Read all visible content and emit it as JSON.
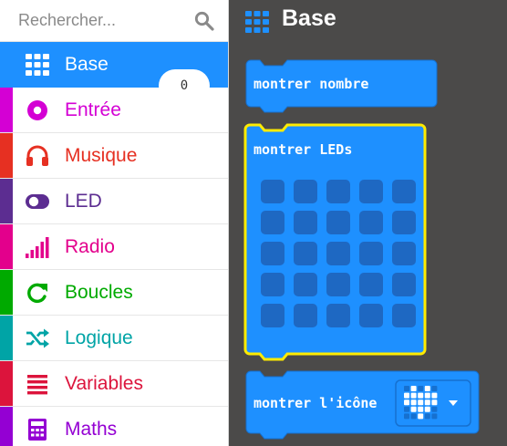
{
  "search": {
    "placeholder": "Rechercher..."
  },
  "categories": [
    {
      "label": "Base",
      "color": "#1e90ff",
      "icon": "grid-icon"
    },
    {
      "label": "Entrée",
      "color": "#d400d4",
      "icon": "radio-button-icon"
    },
    {
      "label": "Musique",
      "color": "#e63022",
      "icon": "headphones-icon"
    },
    {
      "label": "LED",
      "color": "#5c2d91",
      "icon": "toggle-icon"
    },
    {
      "label": "Radio",
      "color": "#e3008c",
      "icon": "signal-bars-icon"
    },
    {
      "label": "Boucles",
      "color": "#00aa00",
      "icon": "refresh-icon"
    },
    {
      "label": "Logique",
      "color": "#00a4a6",
      "icon": "shuffle-icon"
    },
    {
      "label": "Variables",
      "color": "#dc143c",
      "icon": "list-icon"
    },
    {
      "label": "Maths",
      "color": "#9400d3",
      "icon": "calculator-icon"
    }
  ],
  "workspace": {
    "title": "Base",
    "block_color": "#1e90ff",
    "selected_outline": "#ffeb00",
    "show_number": {
      "label": "montrer nombre",
      "value": "0"
    },
    "show_leds": {
      "label": "montrer LEDs",
      "grid": [
        [
          0,
          0,
          0,
          0,
          0
        ],
        [
          0,
          0,
          0,
          0,
          0
        ],
        [
          0,
          0,
          0,
          0,
          0
        ],
        [
          0,
          0,
          0,
          0,
          0
        ],
        [
          0,
          0,
          0,
          0,
          0
        ]
      ]
    },
    "show_icon": {
      "label": "montrer l'icône",
      "selected_icon": "heart-icon",
      "icon_grid": [
        [
          0,
          1,
          0,
          1,
          0
        ],
        [
          1,
          1,
          1,
          1,
          1
        ],
        [
          1,
          1,
          1,
          1,
          1
        ],
        [
          0,
          1,
          1,
          1,
          0
        ],
        [
          0,
          0,
          1,
          0,
          0
        ]
      ]
    }
  }
}
